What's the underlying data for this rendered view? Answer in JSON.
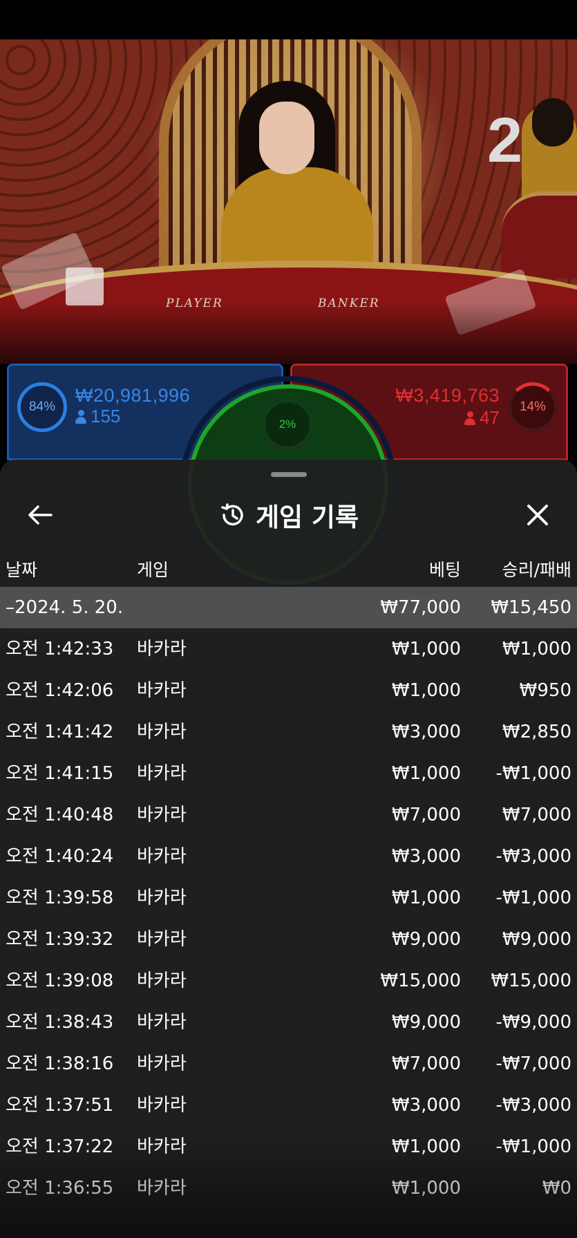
{
  "video": {
    "countdown": "2",
    "table_labels": {
      "player": "PLAYER",
      "banker": "BANKER"
    }
  },
  "bets": {
    "player": {
      "percent": "84%",
      "amount": "₩20,981,996",
      "count": "155",
      "color": "#1b5bb0"
    },
    "tie": {
      "percent": "2%",
      "color": "#1fa52a"
    },
    "banker": {
      "percent": "14%",
      "amount": "₩3,419,763",
      "count": "47",
      "color": "#b82328"
    }
  },
  "sheet": {
    "title": "게임 기록",
    "columns": {
      "date": "날짜",
      "game": "게임",
      "bet": "베팅",
      "result": "승리/패배"
    },
    "date_group": {
      "date": "–2024. 5. 20.",
      "bet": "₩77,000",
      "result": "₩15,450"
    },
    "rows": [
      {
        "time": "오전 1:42:33",
        "game": "바카라",
        "bet": "₩1,000",
        "result": "₩1,000"
      },
      {
        "time": "오전 1:42:06",
        "game": "바카라",
        "bet": "₩1,000",
        "result": "₩950"
      },
      {
        "time": "오전 1:41:42",
        "game": "바카라",
        "bet": "₩3,000",
        "result": "₩2,850"
      },
      {
        "time": "오전 1:41:15",
        "game": "바카라",
        "bet": "₩1,000",
        "result": "-₩1,000"
      },
      {
        "time": "오전 1:40:48",
        "game": "바카라",
        "bet": "₩7,000",
        "result": "₩7,000"
      },
      {
        "time": "오전 1:40:24",
        "game": "바카라",
        "bet": "₩3,000",
        "result": "-₩3,000"
      },
      {
        "time": "오전 1:39:58",
        "game": "바카라",
        "bet": "₩1,000",
        "result": "-₩1,000"
      },
      {
        "time": "오전 1:39:32",
        "game": "바카라",
        "bet": "₩9,000",
        "result": "₩9,000"
      },
      {
        "time": "오전 1:39:08",
        "game": "바카라",
        "bet": "₩15,000",
        "result": "₩15,000"
      },
      {
        "time": "오전 1:38:43",
        "game": "바카라",
        "bet": "₩9,000",
        "result": "-₩9,000"
      },
      {
        "time": "오전 1:38:16",
        "game": "바카라",
        "bet": "₩7,000",
        "result": "-₩7,000"
      },
      {
        "time": "오전 1:37:51",
        "game": "바카라",
        "bet": "₩3,000",
        "result": "-₩3,000"
      },
      {
        "time": "오전 1:37:22",
        "game": "바카라",
        "bet": "₩1,000",
        "result": "-₩1,000"
      },
      {
        "time": "오전 1:36:55",
        "game": "바카라",
        "bet": "₩1,000",
        "result": "₩0"
      }
    ],
    "icons": {
      "back": "arrow-left-icon",
      "history": "history-icon",
      "close": "close-icon"
    }
  }
}
